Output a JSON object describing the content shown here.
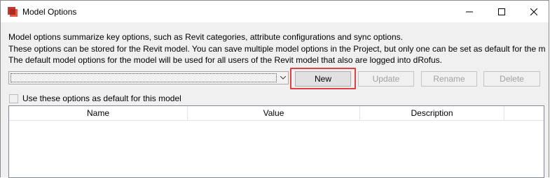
{
  "window": {
    "title": "Model Options",
    "colors": {
      "highlight": "#e0403f",
      "app_icon": "#c8372c"
    }
  },
  "description": {
    "line1": "Model options summarize key options, such as Revit categories, attribute configurations and sync options.",
    "line2": "These options can be stored for the Revit model. You can save multiple model options in the Project, but only one can be set as default for the m",
    "line3": "The default model options for the model will be used for all users of the Revit model that also are logged into dRofus."
  },
  "selector": {
    "value": ""
  },
  "buttons": {
    "new": "New",
    "update": "Update",
    "rename": "Rename",
    "delete": "Delete"
  },
  "default_checkbox": {
    "label": "Use these options as default for this model",
    "checked": false
  },
  "grid": {
    "columns": [
      "Name",
      "Value",
      "Description"
    ],
    "rows": []
  }
}
